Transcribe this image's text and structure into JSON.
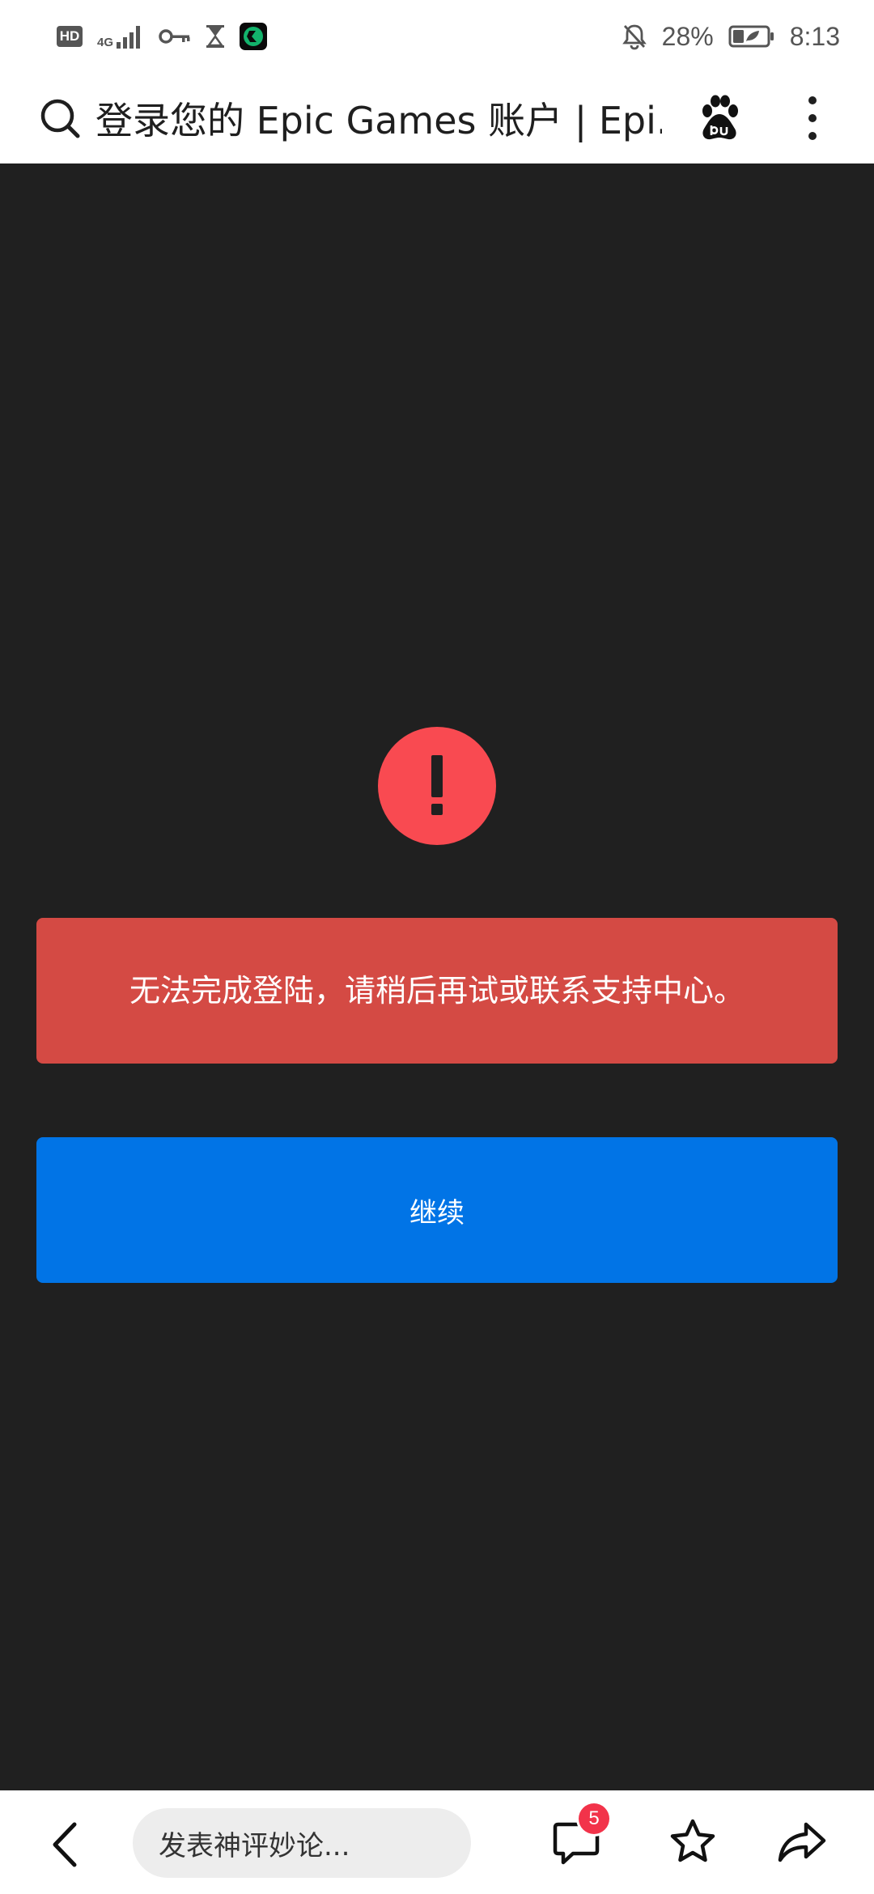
{
  "status_bar": {
    "hd_label": "HD",
    "network_label": "4G",
    "battery_percent": "28%",
    "time": "8:13"
  },
  "address_bar": {
    "page_title": "登录您的 Epic Games 账户 | Epi..."
  },
  "error": {
    "icon_symbol": "!",
    "message": "无法完成登陆，请稍后再试或联系支持中心。"
  },
  "actions": {
    "continue_label": "继续"
  },
  "bottom_bar": {
    "comment_placeholder": "发表神评妙论...",
    "comment_count": "5"
  },
  "colors": {
    "page_background": "#202020",
    "error_icon": "#f94a51",
    "error_banner": "#d44a44",
    "primary_button": "#0174e6",
    "badge": "#f2334a"
  },
  "icons": {
    "status_bar": [
      "hd-icon",
      "signal-icon",
      "vpn-key-icon",
      "hourglass-icon",
      "app-icon",
      "mute-bell-icon",
      "battery-icon"
    ],
    "address_bar": [
      "search-icon",
      "baidu-paw-icon",
      "more-vertical-icon"
    ],
    "bottom_bar": [
      "back-icon",
      "comment-icon",
      "star-icon",
      "share-icon"
    ]
  }
}
